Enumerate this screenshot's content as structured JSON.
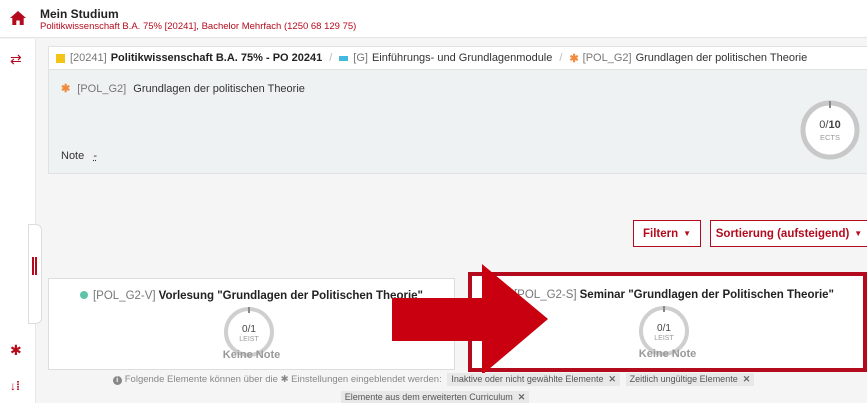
{
  "header": {
    "title": "Mein Studium",
    "subtitle": "Politikwissenschaft B.A. 75% [20241], Bachelor Mehrfach (1250 68 129 75)"
  },
  "breadcrumb": [
    {
      "code": "[20241]",
      "label": "Politikwissenschaft B.A. 75% - PO 20241",
      "marker": "yellow-square"
    },
    {
      "code": "[G]",
      "label": "Einführungs- und Grundlagenmodule",
      "marker": "blue-bar"
    },
    {
      "code": "[POL_G2]",
      "label": "Grundlagen der politischen Theorie",
      "marker": "orange-asterisk"
    }
  ],
  "breadcrumb_separator": "/",
  "module": {
    "code": "[POL_G2]",
    "name": "Grundlagen der politischen Theorie",
    "note_label": "Note",
    "note_value": "-",
    "ects": {
      "value": "0/",
      "total": "10",
      "unit": "ECTS"
    }
  },
  "toolbar": {
    "filter_label": "Filtern",
    "sort_label": "Sortierung (aufsteigend)"
  },
  "cards": [
    {
      "code": "[POL_G2-V]",
      "name": "Vorlesung \"Grundlagen der Politischen Theorie\"",
      "progress": "0/1",
      "unit": "LEIST",
      "grade": "Keine Note",
      "status_color": "#5ec4a8"
    },
    {
      "code": "[POL_G2-S]",
      "name": "Seminar \"Grundlagen der Politischen Theorie\"",
      "progress": "0/1",
      "unit": "LEIST",
      "grade": "Keine Note",
      "status_color": "#5ec4a8"
    }
  ],
  "hint": {
    "text_before": "Folgende Elemente können über die",
    "settings_word": "Einstellungen",
    "text_after": "eingeblendet werden:",
    "tags": [
      "Inaktive oder nicht gewählte Elemente",
      "Zeitlich ungültige Elemente",
      "Elemente aus dem erweiterten Curriculum"
    ]
  },
  "icons": {
    "home": "home-icon",
    "swap": "swap-arrows-icon",
    "settings": "gear-icon",
    "sort": "sort-icon",
    "info": "info-icon",
    "close": "close-icon"
  },
  "colors": {
    "brand": "#b30b1d",
    "status_green": "#5ec4a8",
    "level_yellow": "#f3c318",
    "level_blue": "#45b8e0",
    "level_orange": "#f08a3c",
    "highlight_arrow": "#c8000f"
  }
}
